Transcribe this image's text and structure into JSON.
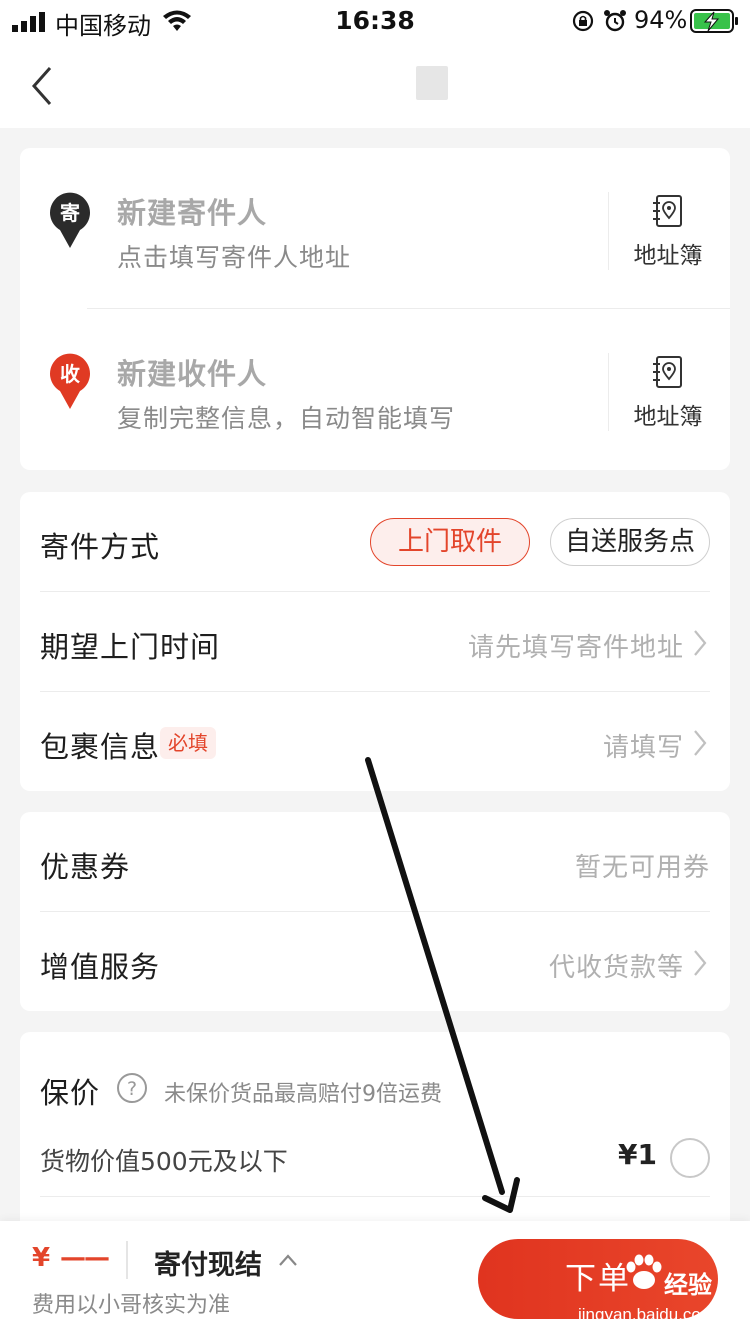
{
  "status_bar": {
    "carrier": "中国移动",
    "time": "16:38",
    "battery": "94%"
  },
  "sender": {
    "badge": "寄",
    "title": "新建寄件人",
    "subtitle": "点击填写寄件人地址",
    "book_label": "地址簿"
  },
  "receiver": {
    "badge": "收",
    "title": "新建收件人",
    "subtitle": "复制完整信息，自动智能填写",
    "book_label": "地址簿"
  },
  "shipping": {
    "method_label": "寄件方式",
    "options": [
      "上门取件",
      "自送服务点"
    ],
    "pickup_time_label": "期望上门时间",
    "pickup_time_value": "请先填写寄件地址",
    "package_label": "包裹信息",
    "package_required": "必填",
    "package_value": "请填写"
  },
  "extras": {
    "coupon_label": "优惠券",
    "coupon_value": "暂无可用券",
    "value_added_label": "增值服务",
    "value_added_value": "代收货款等"
  },
  "insurance": {
    "label": "保价",
    "hint": "未保价货品最高赔付9倍运费",
    "option_label": "货物价值500元及以下",
    "option_price": "¥1"
  },
  "bottom": {
    "price_symbol": "¥",
    "price_value": "——",
    "payment_method": "寄付现结",
    "note": "费用以小哥核实为准",
    "order_button": "下单"
  },
  "watermark": {
    "brand": "经验",
    "url": "jingyan.baidu.com"
  },
  "colors": {
    "accent": "#e3452b",
    "sender_badge": "#2b2b2b",
    "receiver_badge": "#e03a23"
  }
}
